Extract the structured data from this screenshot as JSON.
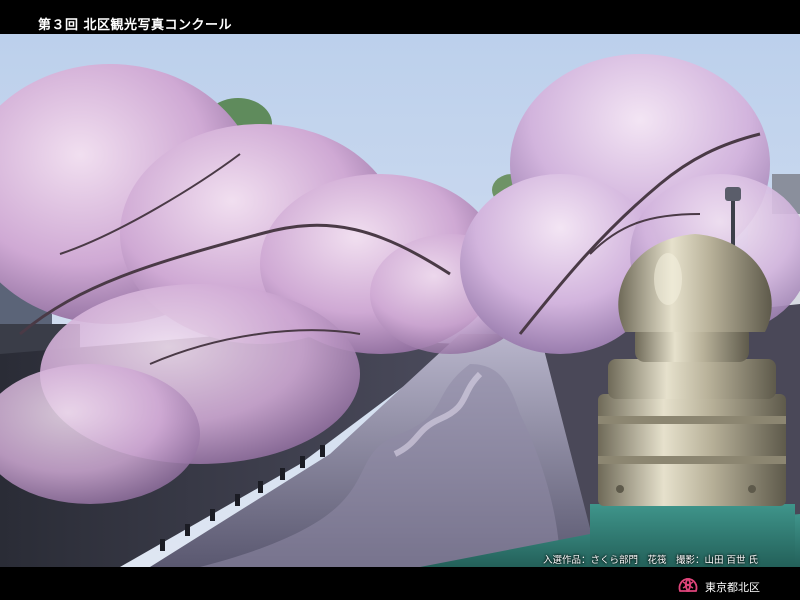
{
  "header": {
    "title": "第３回 北区観光写真コンクール"
  },
  "photo": {
    "subject": "cherry-blossom-river-scene",
    "caption": "入選作品：さくら部門　花筏　撮影：山田 百世 氏"
  },
  "footer": {
    "brand_text": "東京都北区",
    "logo_icon": "kita-ward-emblem-icon"
  },
  "colors": {
    "bar_background": "#000000",
    "text": "#ffffff",
    "emblem": "#e0457b",
    "sky": "#c9d9ee",
    "blossom": "#d9b9df",
    "water": "#6f6f8c",
    "railing": "#2f7d75",
    "finial": "#b8b199"
  }
}
